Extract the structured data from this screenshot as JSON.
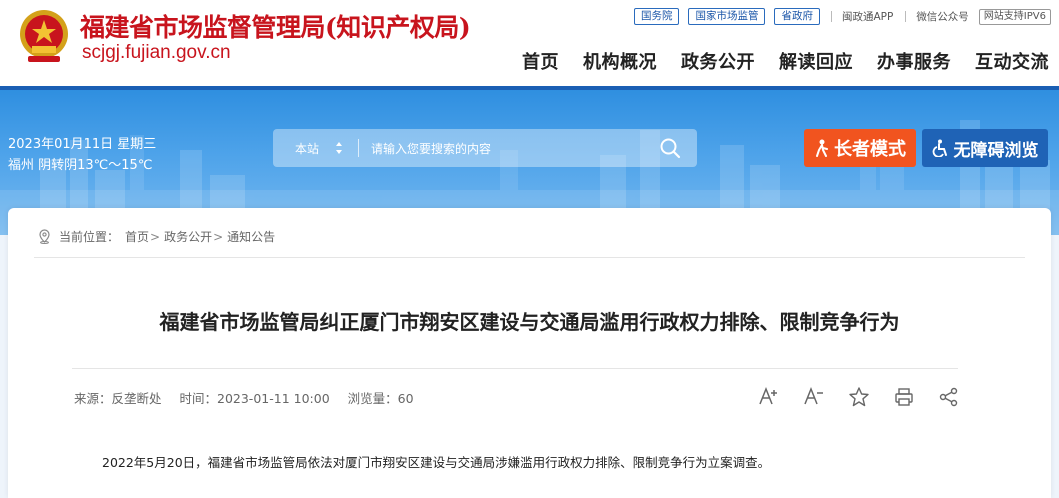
{
  "header": {
    "site_title": "福建省市场监督管理局(知识产权局)",
    "site_domain": "scjgj.fujian.gov.cn",
    "top_links": [
      "国务院",
      "国家市场监管",
      "省政府"
    ],
    "app_link": "闽政通APP",
    "wechat_link": "微信公众号",
    "ipv6_badge": "网站支持IPV6",
    "nav": [
      "首页",
      "机构概况",
      "政务公开",
      "解读回应",
      "办事服务",
      "互动交流"
    ]
  },
  "banner": {
    "date": "2023年01月11日 星期三",
    "weather": "福州 阴转阴13℃～15℃",
    "search_scope": "本站",
    "search_placeholder": "请输入您要搜索的内容",
    "elder_mode_label": "长者模式",
    "accessible_label": "无障碍浏览"
  },
  "breadcrumb": {
    "prefix": "当前位置：",
    "items": [
      "首页",
      "政务公开",
      "通知公告"
    ],
    "separator": ">"
  },
  "article": {
    "title": "福建省市场监管局纠正厦门市翔安区建设与交通局滥用行政权力排除、限制竞争行为",
    "source": "来源：反垄断处",
    "time": "时间：2023-01-11 10:00",
    "views": "浏览量：60",
    "first_paragraph": "2022年5月20日，福建省市场监管局依法对厦门市翔安区建设与交通局涉嫌滥用行政权力排除、限制竞争行为立案调查。"
  },
  "colors": {
    "brand_red": "#c8141d",
    "primary_blue": "#1a5fb4",
    "elder_orange": "#f1541f"
  },
  "icons": [
    "emblem-icon",
    "scope-arrows-icon",
    "search-icon",
    "elder-icon",
    "accessibility-icon",
    "location-icon",
    "font-increase-icon",
    "font-decrease-icon",
    "favorite-icon",
    "print-icon",
    "share-icon"
  ]
}
